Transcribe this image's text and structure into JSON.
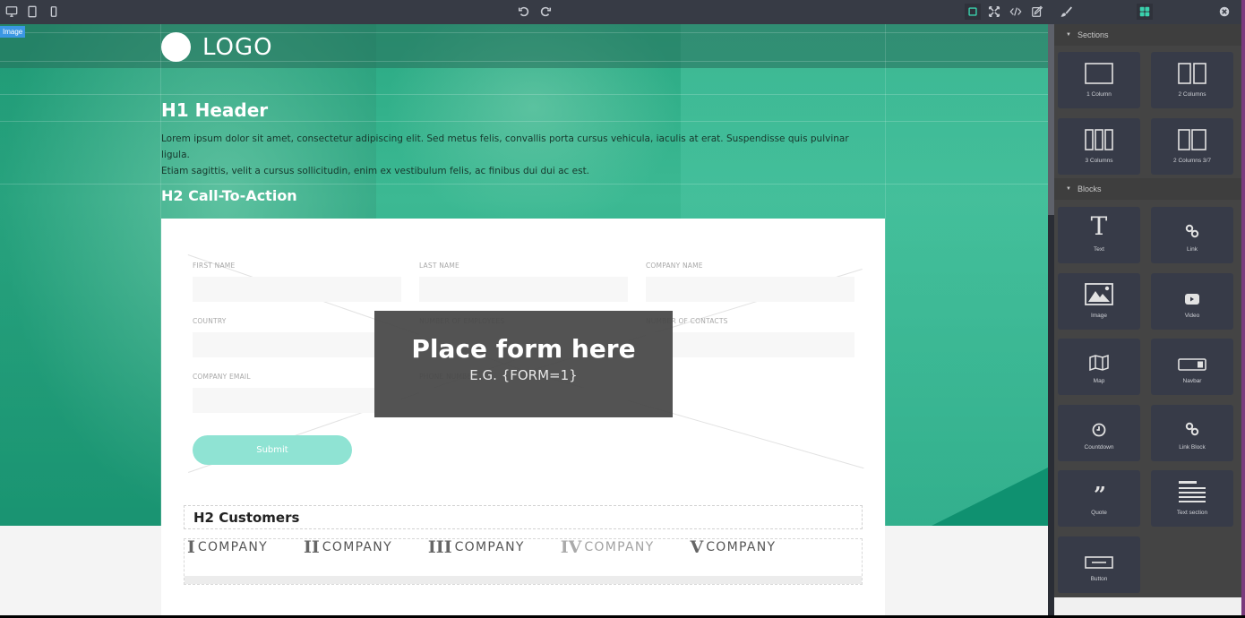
{
  "toolbar": {
    "devices": [
      {
        "name": "desktop",
        "active": true
      },
      {
        "name": "tablet",
        "active": false
      },
      {
        "name": "mobile",
        "active": false
      }
    ],
    "history": [
      "undo",
      "redo"
    ],
    "options": [
      "sw-visibility",
      "fullscreen",
      "export-code",
      "import"
    ],
    "panels": [
      "style-manager",
      "blocks"
    ],
    "accent": "#3ad1ad"
  },
  "canvas": {
    "selected_badge": "Image",
    "logo_text": "LOGO",
    "h1": "H1 Header",
    "lorem_line1": "Lorem ipsum dolor sit amet, consectetur adipiscing elit. Sed metus felis, convallis porta cursus vehicula, iaculis at erat. Suspendisse quis pulvinar ligula.",
    "lorem_line2": "Etiam sagittis, velit a cursus sollicitudin, enim ex vestibulum felis, ac finibus dui dui ac est.",
    "h2_cta": "H2 Call-To-Action",
    "form": {
      "fields": [
        {
          "label": "FIRST NAME",
          "value": ""
        },
        {
          "label": "LAST NAME",
          "value": ""
        },
        {
          "label": "COMPANY NAME",
          "value": ""
        },
        {
          "label": "COUNTRY",
          "value": ""
        },
        {
          "label": "NUMBER OF EMPLOYEES",
          "value": ""
        },
        {
          "label": "NUMBER OF CONTACTS",
          "value": ""
        },
        {
          "label": "COMPANY EMAIL",
          "value": ""
        },
        {
          "label": "PHONE NUMBER",
          "value": ""
        }
      ],
      "submit_label": "Submit",
      "submit_color": "#8fe3d3"
    },
    "placeholder": {
      "title": "Place form here",
      "subtitle": "E.G. {FORM=1}"
    },
    "customers": {
      "title": "H2 Customers",
      "logos": [
        {
          "numeral": "I",
          "name": "COMPANY"
        },
        {
          "numeral": "II",
          "name": "COMPANY"
        },
        {
          "numeral": "III",
          "name": "COMPANY"
        },
        {
          "numeral": "IV",
          "name": "COMPANY"
        },
        {
          "numeral": "V",
          "name": "COMPANY"
        }
      ]
    }
  },
  "panel": {
    "sections_title": "Sections",
    "sections": [
      {
        "label": "1 Column",
        "icon": "one-column"
      },
      {
        "label": "2 Columns",
        "icon": "two-columns"
      },
      {
        "label": "3 Columns",
        "icon": "three-columns"
      },
      {
        "label": "2 Columns 3/7",
        "icon": "two-columns-3-7"
      }
    ],
    "blocks_title": "Blocks",
    "blocks": [
      {
        "label": "Text",
        "icon": "text"
      },
      {
        "label": "Link",
        "icon": "link"
      },
      {
        "label": "Image",
        "icon": "image"
      },
      {
        "label": "Video",
        "icon": "video"
      },
      {
        "label": "Map",
        "icon": "map"
      },
      {
        "label": "Navbar",
        "icon": "navbar"
      },
      {
        "label": "Countdown",
        "icon": "countdown"
      },
      {
        "label": "Link Block",
        "icon": "link-block"
      },
      {
        "label": "Quote",
        "icon": "quote"
      },
      {
        "label": "Text section",
        "icon": "text-section"
      },
      {
        "label": "Button",
        "icon": "button"
      }
    ]
  }
}
